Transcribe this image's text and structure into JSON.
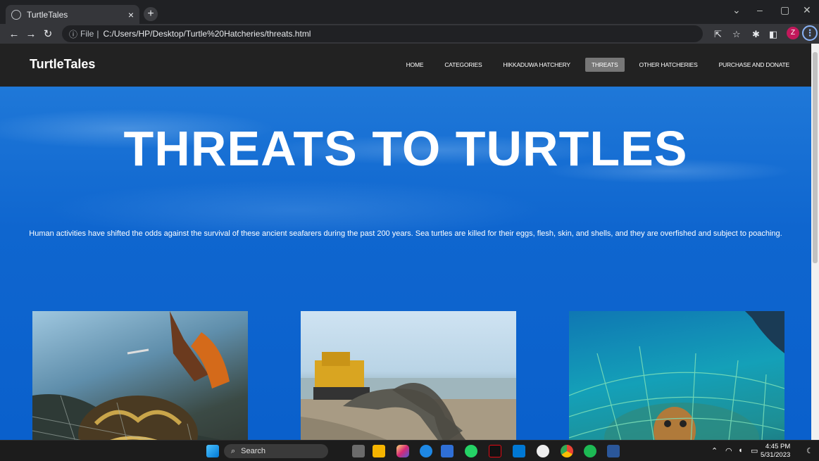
{
  "browser": {
    "tab_title": "TurtleTales",
    "tab_close": "×",
    "new_tab": "+",
    "url_prefix": "File",
    "url": "C:/Users/HP/Desktop/Turtle%20Hatcheries/threats.html",
    "profile_initial": "Z"
  },
  "site": {
    "brand": "TurtleTales",
    "nav": [
      {
        "label": "HOME"
      },
      {
        "label": "CATEGORIES"
      },
      {
        "label": "HIKKADUWA HATCHERY"
      },
      {
        "label": "THREATS",
        "active": true
      },
      {
        "label": "OTHER HATCHERIES"
      },
      {
        "label": "PURCHASE AND DONATE"
      }
    ]
  },
  "hero": {
    "title": "THREATS TO TURTLES",
    "text": "Human activities have shifted the odds against the survival of these ancient seafarers during the past 200 years. Sea turtles are killed for their eggs, flesh, skin, and shells, and they are overfished and subject to poaching."
  },
  "taskbar": {
    "search_label": "Search",
    "time": "4:45 PM",
    "date": "5/31/2023"
  },
  "colors": {
    "nav_bg": "#222222",
    "nav_active": "#777777",
    "hero_blue": "#0a63cf"
  }
}
